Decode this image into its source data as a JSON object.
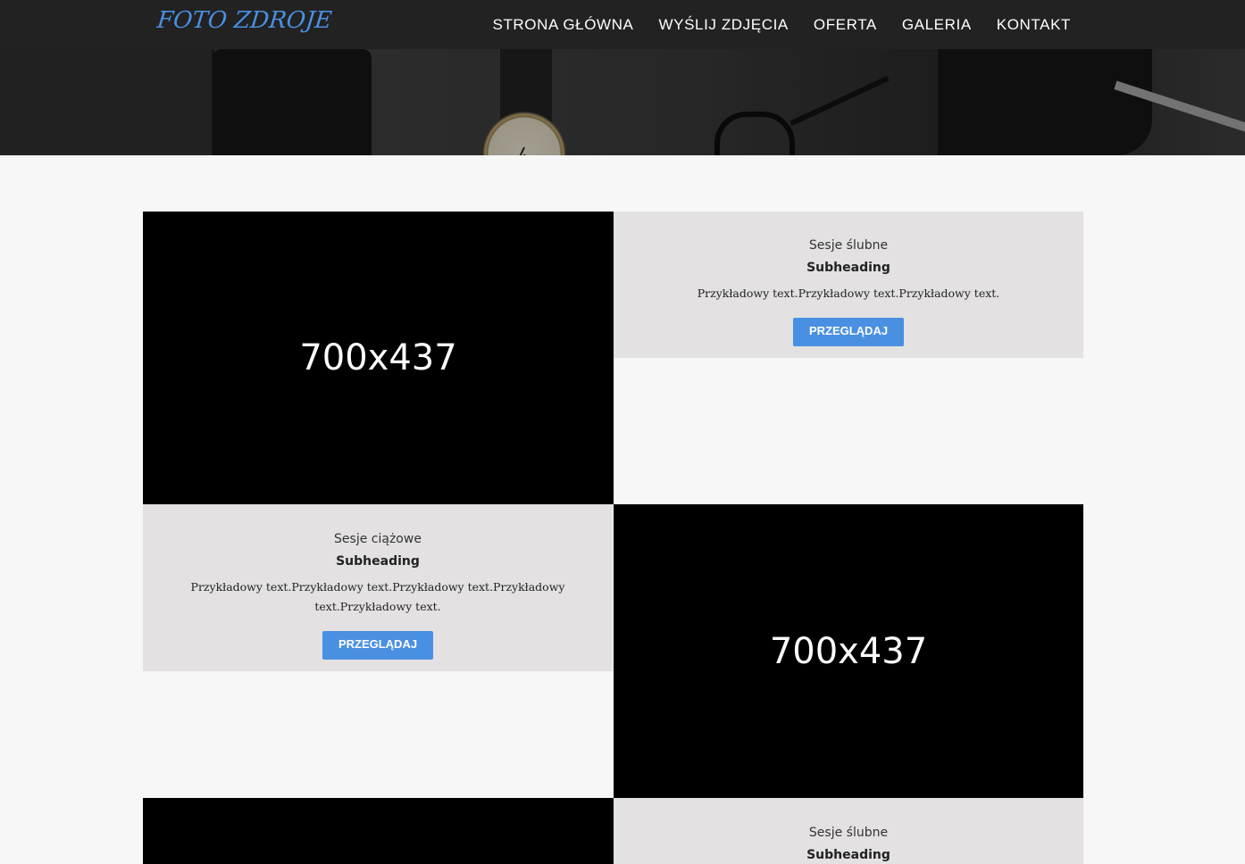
{
  "brand": "FOTO ZDROJE",
  "nav": [
    "STRONA GŁÓWNA",
    "WYŚLIJ ZDJĘCIA",
    "OFERTA",
    "GALERIA",
    "KONTAKT"
  ],
  "colors": {
    "accent": "#4a90e2",
    "navbar": "#222222",
    "card": "#e3e1e1"
  },
  "rows": [
    {
      "image_label": "700x437",
      "title": "Sesje ślubne",
      "subheading": "Subheading",
      "text": "Przykładowy text.Przykładowy text.Przykładowy text.",
      "button": "PRZEGLĄDAJ"
    },
    {
      "image_label": "700x437",
      "title": "Sesje ciążowe",
      "subheading": "Subheading",
      "text": "Przykładowy text.Przykładowy text.Przykładowy text.Przykładowy text.Przykładowy text.",
      "button": "PRZEGLĄDAJ"
    },
    {
      "image_label": "",
      "title": "Sesje ślubne",
      "subheading": "Subheading",
      "text": "",
      "button": ""
    }
  ]
}
